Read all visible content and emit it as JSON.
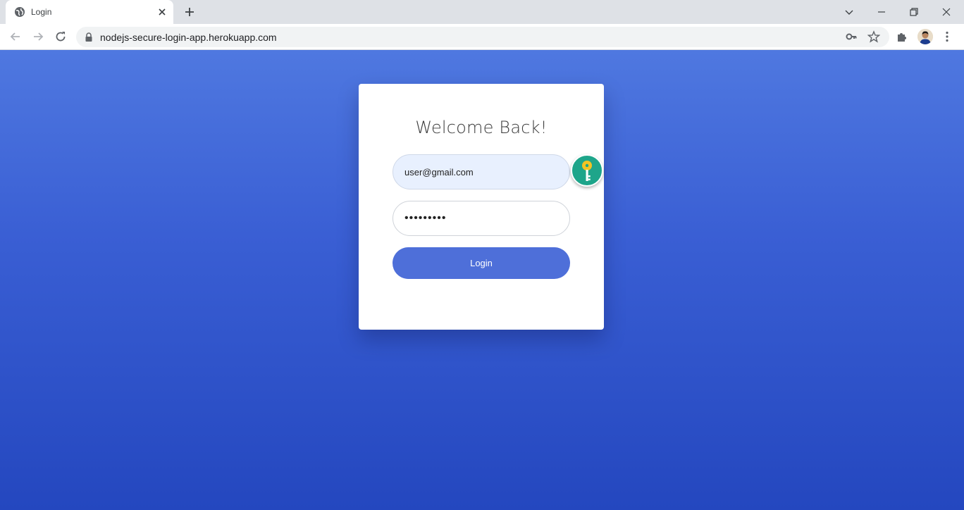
{
  "browser": {
    "tab": {
      "title": "Login"
    },
    "address": {
      "url": "nodejs-secure-login-app.herokuapp.com"
    }
  },
  "login_form": {
    "heading": "Welcome Back!",
    "email_value": "user@gmail.com",
    "password_value": "•••••••••",
    "submit_label": "Login"
  },
  "colors": {
    "page_gradient_top": "#4f78e0",
    "page_gradient_bottom": "#2447bf",
    "button": "#4e6fd9",
    "email_autofill_bg": "#e8f0fe",
    "key_badge": "#1ea58a"
  },
  "icons": {
    "tab_favicon": "globe-icon",
    "tab_close": "close-icon",
    "new_tab": "plus-icon",
    "tab_search": "chevron-down-icon",
    "back": "arrow-left-icon",
    "forward": "arrow-right-icon",
    "reload": "reload-icon",
    "lock": "lock-icon",
    "passwords": "key-icon",
    "bookmark": "star-icon",
    "extensions": "puzzle-icon",
    "menu": "kebab-menu-icon",
    "password_manager_badge": "key-icon"
  }
}
